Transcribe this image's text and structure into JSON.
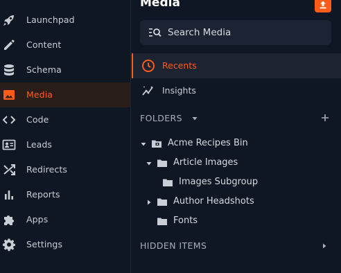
{
  "nav": {
    "items": [
      {
        "label": "Launchpad",
        "icon": "rocket-icon"
      },
      {
        "label": "Content",
        "icon": "pencil-icon"
      },
      {
        "label": "Schema",
        "icon": "database-icon"
      },
      {
        "label": "Media",
        "icon": "image-icon",
        "active": true
      },
      {
        "label": "Code",
        "icon": "code-icon"
      },
      {
        "label": "Leads",
        "icon": "contact-card-icon"
      },
      {
        "label": "Redirects",
        "icon": "shuffle-icon"
      },
      {
        "label": "Reports",
        "icon": "bar-chart-icon"
      },
      {
        "label": "Apps",
        "icon": "puzzle-icon"
      },
      {
        "label": "Settings",
        "icon": "gear-icon"
      }
    ]
  },
  "panel": {
    "title": "Media",
    "upload_icon": "upload-icon",
    "search": {
      "placeholder": "Search Media",
      "icon": "search-icon"
    },
    "tabs": [
      {
        "label": "Recents",
        "icon": "clock-icon",
        "active": true
      },
      {
        "label": "Insights",
        "icon": "insights-icon"
      }
    ],
    "folders_header": "FOLDERS",
    "tree": [
      {
        "name": "Acme Recipes Bin",
        "depth": 0,
        "expanded": true,
        "has_children": true,
        "bin": true
      },
      {
        "name": "Article Images",
        "depth": 1,
        "expanded": true,
        "has_children": true
      },
      {
        "name": "Images Subgroup",
        "depth": 2,
        "has_children": false
      },
      {
        "name": "Author Headshots",
        "depth": 1,
        "expanded": false,
        "has_children": true
      },
      {
        "name": "Fonts",
        "depth": 1,
        "has_children": false
      }
    ],
    "hidden_header": "HIDDEN ITEMS"
  },
  "colors": {
    "accent": "#ff5c1a",
    "background": "#0f1724",
    "search_bg": "#1c2433"
  }
}
